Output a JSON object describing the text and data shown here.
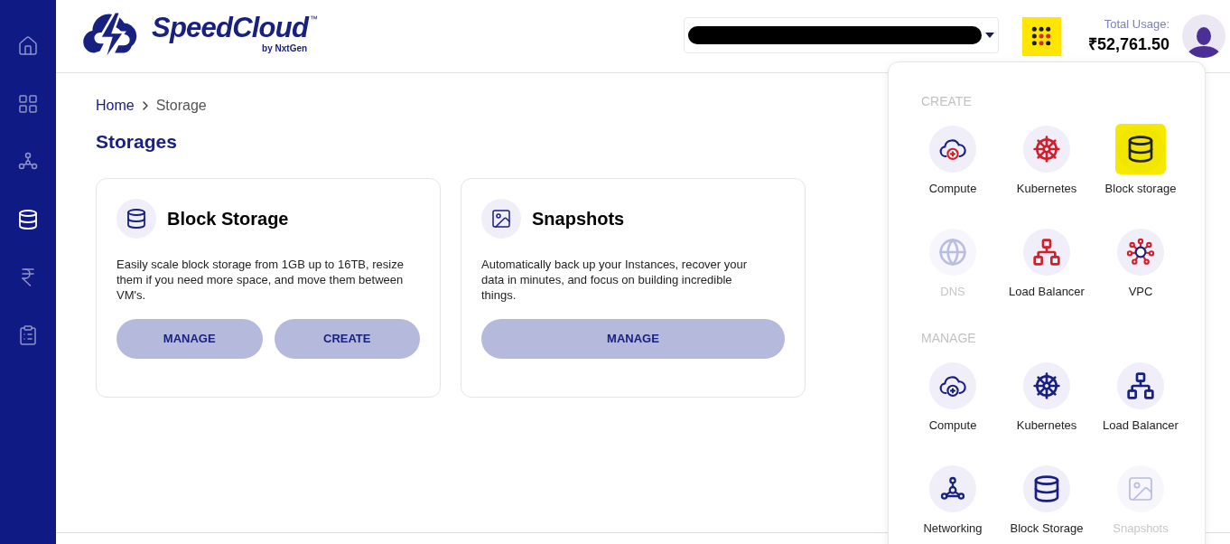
{
  "sidebar": {
    "items": [
      {
        "selected": false
      },
      {
        "selected": false
      },
      {
        "selected": false
      },
      {
        "selected": true
      },
      {
        "selected": false
      },
      {
        "selected": false
      }
    ]
  },
  "header": {
    "logo": {
      "name": "SpeedCloud",
      "trademark": "™",
      "byline": "by NxtGen"
    },
    "apps_button": {
      "highlighted": true
    },
    "usage": {
      "label": "Total Usage:",
      "amount": "₹52,761.50"
    }
  },
  "breadcrumb": [
    {
      "label": "Home",
      "kind": "link"
    },
    {
      "label": "Storage",
      "kind": "current"
    }
  ],
  "page_title": "Storages",
  "cards": [
    {
      "title": "Block Storage",
      "description": "Easily scale block storage from 1GB up to 16TB, resize them if you need more space, and move them between VM's.",
      "buttons": [
        "MANAGE",
        "CREATE"
      ]
    },
    {
      "title": "Snapshots",
      "description": "Automatically back up your Instances, recover your data in minutes, and focus on building incredible things.",
      "buttons": [
        "MANAGE"
      ]
    }
  ],
  "apps_menu": {
    "sections": [
      {
        "title": "CREATE",
        "kind": "create",
        "items": [
          {
            "label": "Compute",
            "disabled": false,
            "highlighted": false
          },
          {
            "label": "Kubernetes",
            "disabled": false,
            "highlighted": false
          },
          {
            "label": "Block storage",
            "disabled": false,
            "highlighted": true
          },
          {
            "label": "DNS",
            "disabled": true,
            "highlighted": false
          },
          {
            "label": "Load Balancer",
            "disabled": false,
            "highlighted": false
          },
          {
            "label": "VPC",
            "disabled": false,
            "highlighted": false
          }
        ]
      },
      {
        "title": "MANAGE",
        "kind": "manage",
        "items": [
          {
            "label": "Compute",
            "disabled": false,
            "highlighted": false
          },
          {
            "label": "Kubernetes",
            "disabled": false,
            "highlighted": false
          },
          {
            "label": "Load Balancer",
            "disabled": false,
            "highlighted": false
          },
          {
            "label": "Networking",
            "disabled": false,
            "highlighted": false
          },
          {
            "label": "Block Storage",
            "disabled": false,
            "highlighted": false
          },
          {
            "label": "Snapshots",
            "disabled": true,
            "highlighted": false
          }
        ]
      }
    ]
  }
}
